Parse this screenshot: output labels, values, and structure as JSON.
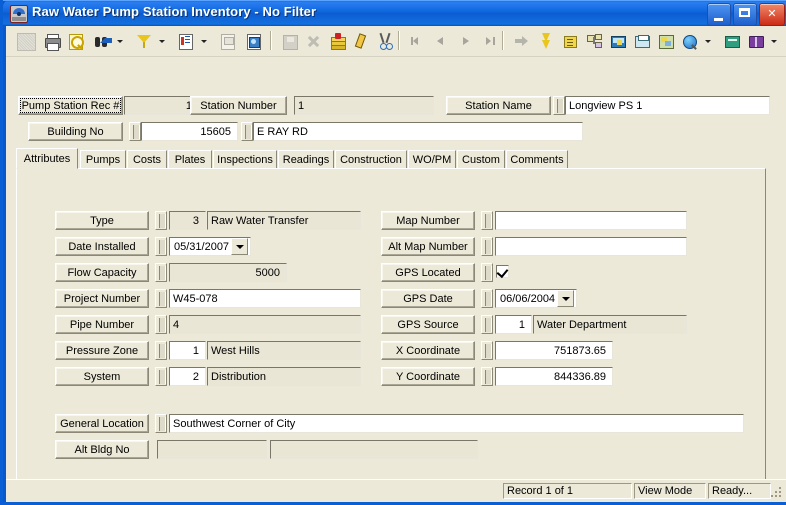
{
  "window": {
    "title": "Raw Water Pump Station Inventory - No Filter",
    "icon": "pump-station-icon",
    "minimize": "_",
    "maximize": "□",
    "close": "✕"
  },
  "toolbar": {
    "items": [
      {
        "name": "new-record-button",
        "icon": "blank-page-icon",
        "disabled": true
      },
      {
        "name": "print-button",
        "icon": "printer-icon",
        "disabled": false
      },
      {
        "name": "print-preview-button",
        "icon": "magnifier-page-icon",
        "disabled": false
      },
      {
        "name": "find-button",
        "icon": "binoculars-icon",
        "disabled": false
      },
      {
        "name": "find-dropdown",
        "icon": "chevron-down-icon",
        "disabled": false
      },
      {
        "name": "filter-button",
        "icon": "funnel-icon",
        "disabled": false
      },
      {
        "name": "filter-dropdown",
        "icon": "chevron-down-icon",
        "disabled": false
      },
      {
        "name": "report-button",
        "icon": "report-page-icon",
        "disabled": false
      },
      {
        "name": "report-dropdown",
        "icon": "chevron-down-icon",
        "disabled": false
      },
      {
        "name": "properties-button",
        "icon": "properties-page-icon",
        "disabled": true
      },
      {
        "name": "copy-record-button",
        "icon": "copy-page-icon",
        "disabled": false
      },
      {
        "name": "save-button",
        "icon": "floppy-disk-icon",
        "disabled": true
      },
      {
        "name": "delete-button",
        "icon": "x-delete-icon",
        "disabled": true
      },
      {
        "name": "add-record-button",
        "icon": "add-stack-icon",
        "disabled": false
      },
      {
        "name": "edit-button",
        "icon": "pencil-icon",
        "disabled": false
      },
      {
        "name": "cut-button",
        "icon": "scissors-icon",
        "disabled": false
      },
      {
        "name": "first-record-button",
        "icon": "first-record-icon",
        "disabled": true
      },
      {
        "name": "previous-record-button",
        "icon": "previous-record-icon",
        "disabled": true
      },
      {
        "name": "next-record-button",
        "icon": "next-record-icon",
        "disabled": true
      },
      {
        "name": "last-record-button",
        "icon": "last-record-icon",
        "disabled": true
      },
      {
        "name": "goto-button",
        "icon": "right-arrow-icon",
        "disabled": true
      },
      {
        "name": "quick-action-button",
        "icon": "lightning-bolt-icon",
        "disabled": false
      },
      {
        "name": "layout-button",
        "icon": "yellow-form-icon",
        "disabled": false
      },
      {
        "name": "hierarchy-button",
        "icon": "tree-nodes-icon",
        "disabled": false
      },
      {
        "name": "screen-button",
        "icon": "monitor-icon",
        "disabled": false
      },
      {
        "name": "fax-button",
        "icon": "fax-machine-icon",
        "disabled": false
      },
      {
        "name": "map-button",
        "icon": "map-image-icon",
        "disabled": false
      },
      {
        "name": "globe-button",
        "icon": "globe-magnifier-icon",
        "disabled": false
      },
      {
        "name": "globe-dropdown",
        "icon": "chevron-down-icon",
        "disabled": false
      },
      {
        "name": "calculator-button",
        "icon": "calculator-icon",
        "disabled": false
      },
      {
        "name": "help-book-button",
        "icon": "purple-book-icon",
        "disabled": false
      },
      {
        "name": "help-dropdown",
        "icon": "chevron-down-icon",
        "disabled": false
      },
      {
        "name": "email-button",
        "icon": "red-envelope-icon",
        "disabled": false
      }
    ]
  },
  "header": {
    "rec_label": "Pump Station Rec #",
    "rec_value": "1",
    "station_number_label": "Station Number",
    "station_number_value": "1",
    "station_name_label": "Station Name",
    "station_name_value": "Longview PS 1",
    "building_no_label": "Building No",
    "building_no_value": "15605",
    "street_value": "E RAY RD"
  },
  "tabs": [
    {
      "label": "Attributes",
      "active": true
    },
    {
      "label": "Pumps",
      "active": false
    },
    {
      "label": "Costs",
      "active": false
    },
    {
      "label": "Plates",
      "active": false
    },
    {
      "label": "Inspections",
      "active": false
    },
    {
      "label": "Readings",
      "active": false
    },
    {
      "label": "Construction",
      "active": false
    },
    {
      "label": "WO/PM",
      "active": false
    },
    {
      "label": "Custom",
      "active": false
    },
    {
      "label": "Comments",
      "active": false
    }
  ],
  "left_fields": [
    {
      "label": "Type",
      "code": "3",
      "value": "Raw Water Transfer",
      "kind": "code-desc",
      "readonly": true
    },
    {
      "label": "Date Installed",
      "value": "05/31/2007",
      "kind": "date",
      "readonly": false
    },
    {
      "label": "Flow Capacity",
      "value": "5000",
      "kind": "number-ro",
      "readonly": true
    },
    {
      "label": "Project Number",
      "value": "W45-078",
      "kind": "text",
      "readonly": false
    },
    {
      "label": "Pipe Number",
      "value": "4",
      "kind": "text-ro",
      "readonly": true
    },
    {
      "label": "Pressure Zone",
      "code": "1",
      "value": "West Hills",
      "kind": "code-desc-edit",
      "readonly": false
    },
    {
      "label": "System",
      "code": "2",
      "value": "Distribution",
      "kind": "code-desc-edit",
      "readonly": false
    }
  ],
  "right_fields": [
    {
      "label": "Map Number",
      "value": "",
      "kind": "text",
      "readonly": false
    },
    {
      "label": "Alt Map Number",
      "value": "",
      "kind": "text",
      "readonly": false
    },
    {
      "label": "GPS Located",
      "value": "",
      "kind": "checkbox",
      "checked": true
    },
    {
      "label": "GPS Date",
      "value": "06/06/2004",
      "kind": "date",
      "readonly": false
    },
    {
      "label": "GPS Source",
      "code": "1",
      "value": "Water Department",
      "kind": "code-desc-edit",
      "readonly": false
    },
    {
      "label": "X Coordinate",
      "value": "751873.65",
      "kind": "number",
      "readonly": false
    },
    {
      "label": "Y Coordinate",
      "value": "844336.89",
      "kind": "number",
      "readonly": false
    }
  ],
  "bottom_fields": {
    "general_location_label": "General Location",
    "general_location_value": "Southwest Corner of City",
    "alt_bldg_no_label": "Alt Bldg No",
    "alt_bldg_no_value": "",
    "alt_bldg_desc_value": ""
  },
  "status": {
    "record": "Record 1 of 1",
    "mode": "View Mode",
    "ready": "Ready..."
  },
  "colors": {
    "face": "#ece9d8",
    "readonly_field": "#e9e6d6",
    "title_blue": "#0a5fd6",
    "close_red": "#cc2a16"
  }
}
